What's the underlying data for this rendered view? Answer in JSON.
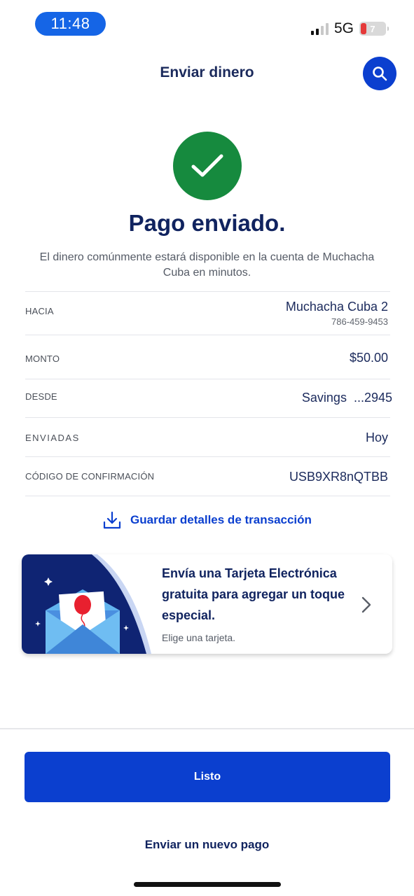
{
  "status_bar": {
    "time": "11:48",
    "network": "5G",
    "battery_level": "7",
    "battery_icon": "battery-charging-icon",
    "signal_icon": "signal-bars-icon"
  },
  "header": {
    "title": "Enviar dinero",
    "search_icon": "search-icon"
  },
  "success": {
    "icon": "check-icon",
    "title": "Pago enviado.",
    "message": "El dinero comúnmente estará disponible en la cuenta de Muchacha Cuba en minutos."
  },
  "details": {
    "to_label": "HACIA",
    "to_name": "Muchacha Cuba 2",
    "to_phone": "786-459-9453",
    "amount_label": "MONTO",
    "amount_value": "$50.00",
    "from_label": "DESDE",
    "from_value": "Savings  ...2945",
    "sent_label": "ENVIADAS",
    "sent_value": "Hoy",
    "code_label": "CÓDIGO DE CONFIRMACIÓN",
    "code_value": "USB9XR8nQTBB"
  },
  "save_details": {
    "label": "Guardar detalles de transacción",
    "icon": "download-icon"
  },
  "ecard": {
    "title": "Envía una Tarjeta Electrónica gratuita para agregar un toque especial.",
    "subtitle": "Elige una tarjeta.",
    "icon": "chevron-right-icon",
    "colors": {
      "navy": "#0f2473",
      "sky": "#62b4ef",
      "balloon": "#e8202f"
    }
  },
  "footer": {
    "primary_label": "Listo",
    "secondary_label": "Enviar un nuevo pago"
  },
  "colors": {
    "brand_blue": "#0b3fcf",
    "success_green": "#168a3e",
    "navy_text": "#10235f"
  }
}
